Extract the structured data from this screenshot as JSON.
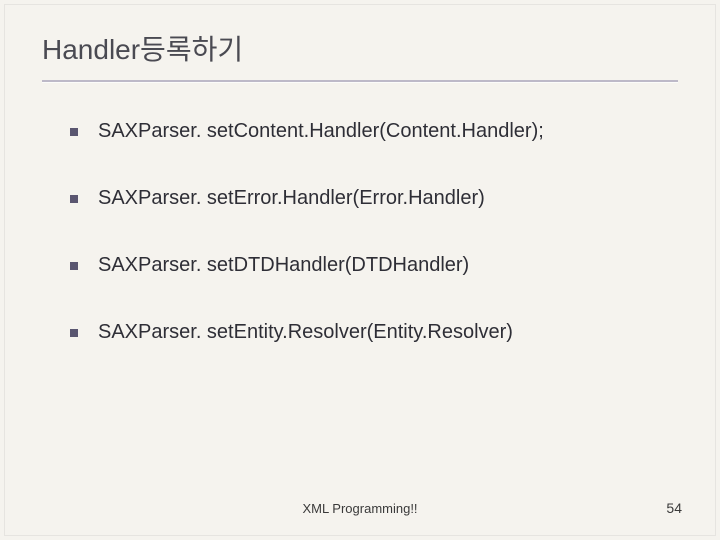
{
  "slide": {
    "title": "Handler등록하기",
    "bullets": [
      {
        "text": "SAXParser. setContent.Handler(Content.Handler);"
      },
      {
        "text": "SAXParser. setError.Handler(Error.Handler)"
      },
      {
        "text": "SAXParser. setDTDHandler(DTDHandler)"
      },
      {
        "text": "SAXParser. setEntity.Resolver(Entity.Resolver)"
      }
    ],
    "footer": "XML Programming!!",
    "pageNumber": "54"
  }
}
